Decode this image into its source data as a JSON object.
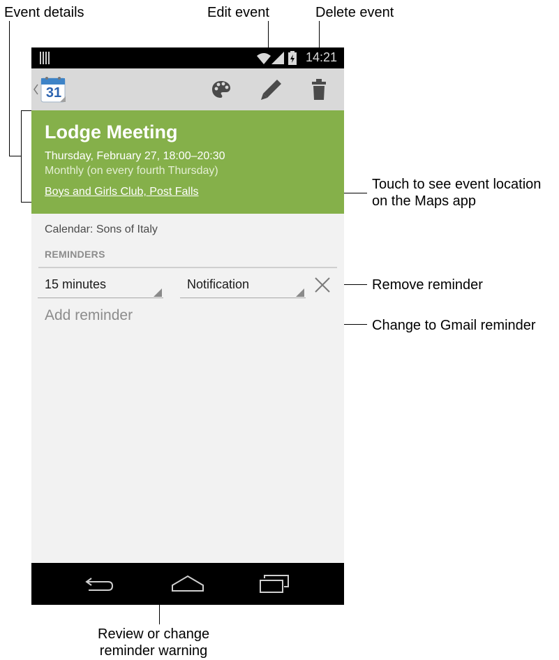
{
  "callouts": {
    "event_details": "Event details",
    "edit_event": "Edit event",
    "delete_event": "Delete event",
    "touch_location_line1": "Touch to see event location",
    "touch_location_line2": "on the Maps app",
    "remove_reminder": "Remove reminder",
    "change_gmail": "Change to Gmail reminder",
    "review_line1": "Review or change",
    "review_line2": "reminder warning"
  },
  "status_bar": {
    "time": "14:21"
  },
  "action_bar": {
    "calendar_day": "31",
    "icons": [
      "palette-icon",
      "edit-icon",
      "delete-icon"
    ]
  },
  "event": {
    "title": "Lodge Meeting",
    "datetime": "Thursday, February 27, 18:00–20:30",
    "recurrence": "Monthly (on every fourth Thursday)",
    "location": "Boys and Girls Club, Post Falls",
    "calendar": "Calendar: Sons of Italy",
    "header_color": "#85b04a"
  },
  "reminders": {
    "header": "REMINDERS",
    "items": [
      {
        "time": "15 minutes",
        "method": "Notification"
      }
    ],
    "add_label": "Add reminder"
  },
  "nav_icons": [
    "back-icon",
    "home-icon",
    "recent-apps-icon"
  ]
}
